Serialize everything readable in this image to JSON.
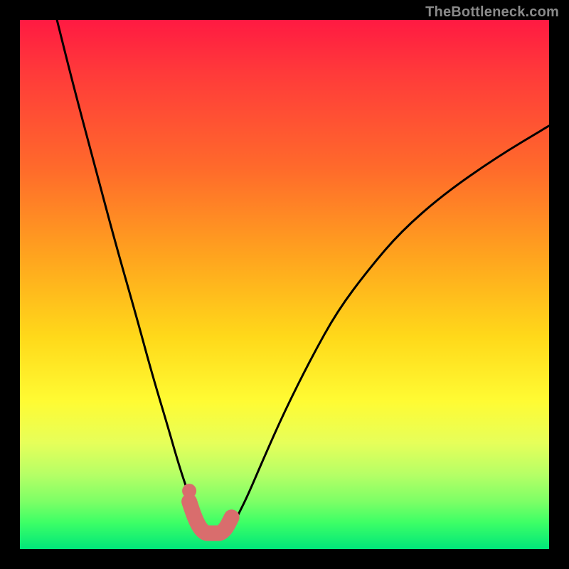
{
  "watermark": "TheBottleneck.com",
  "chart_data": {
    "type": "line",
    "title": "",
    "xlabel": "",
    "ylabel": "",
    "xlim": [
      0,
      100
    ],
    "ylim": [
      0,
      100
    ],
    "series": [
      {
        "name": "bottleneck-curve",
        "x": [
          7,
          10,
          14,
          18,
          22,
          25,
          28,
          30,
          32,
          33,
          34,
          35,
          36,
          37,
          38,
          39,
          40,
          41,
          43,
          46,
          50,
          55,
          60,
          66,
          72,
          80,
          90,
          100
        ],
        "values": [
          100,
          88,
          73,
          58,
          44,
          33,
          23,
          16,
          10,
          7,
          5,
          3,
          2,
          2,
          2,
          3,
          4,
          6,
          10,
          17,
          26,
          36,
          45,
          53,
          60,
          67,
          74,
          80
        ]
      },
      {
        "name": "optimal-region-marker",
        "x": [
          32,
          33,
          34,
          35,
          36,
          37,
          38,
          39,
          40
        ],
        "values": [
          9,
          6,
          4,
          3,
          3,
          3,
          3,
          4,
          6
        ]
      }
    ],
    "colors": {
      "curve": "#000000",
      "marker": "#d96d6d",
      "gradient_top": "#ff1a42",
      "gradient_mid": "#ffd91a",
      "gradient_bottom": "#00e67a"
    }
  }
}
